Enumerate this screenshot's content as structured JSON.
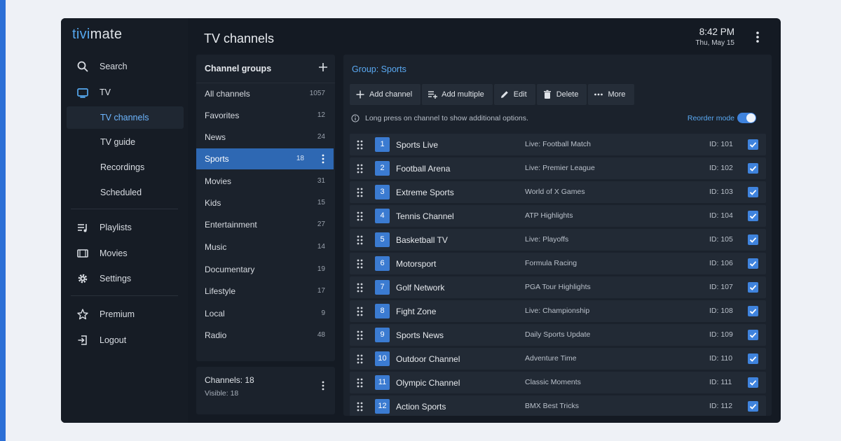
{
  "app": {
    "logo_part1": "tivi",
    "logo_part2": "mate",
    "title": "TV channels",
    "time": "8:42 PM",
    "date": "Thu, May 15"
  },
  "sidebar": {
    "search": "Search",
    "tv": "TV",
    "tv_channels": "TV channels",
    "tv_guide": "TV guide",
    "recordings": "Recordings",
    "scheduled": "Scheduled",
    "playlists": "Playlists",
    "movies": "Movies",
    "settings": "Settings",
    "premium": "Premium",
    "logout": "Logout"
  },
  "groups": {
    "header": "Channel groups",
    "items": [
      {
        "name": "All channels",
        "count": "1057"
      },
      {
        "name": "Favorites",
        "count": "12"
      },
      {
        "name": "News",
        "count": "24"
      },
      {
        "name": "Sports",
        "count": "18"
      },
      {
        "name": "Movies",
        "count": "31"
      },
      {
        "name": "Kids",
        "count": "15"
      },
      {
        "name": "Entertainment",
        "count": "27"
      },
      {
        "name": "Music",
        "count": "14"
      },
      {
        "name": "Documentary",
        "count": "19"
      },
      {
        "name": "Lifestyle",
        "count": "17"
      },
      {
        "name": "Local",
        "count": "9"
      },
      {
        "name": "Radio",
        "count": "48"
      }
    ]
  },
  "summary": {
    "channels": "Channels: 18",
    "visible": "Visible:  18"
  },
  "channels": {
    "group_label": "Group: Sports",
    "toolbar": {
      "add_channel": "Add channel",
      "add_multiple": "Add multiple",
      "edit": "Edit",
      "delete": "Delete",
      "more": "More"
    },
    "hint": "Long press on channel to show additional options.",
    "reorder_label": "Reorder mode",
    "reorder_on": true,
    "rows": [
      {
        "num": "1",
        "name": "Sports Live",
        "program": "Live: Football Match",
        "id": "ID: 101"
      },
      {
        "num": "2",
        "name": "Football Arena",
        "program": "Live: Premier League",
        "id": "ID: 102"
      },
      {
        "num": "3",
        "name": "Extreme Sports",
        "program": "World of X Games",
        "id": "ID: 103"
      },
      {
        "num": "4",
        "name": "Tennis Channel",
        "program": "ATP Highlights",
        "id": "ID: 104"
      },
      {
        "num": "5",
        "name": "Basketball TV",
        "program": "Live: Playoffs",
        "id": "ID: 105"
      },
      {
        "num": "6",
        "name": "Motorsport",
        "program": "Formula Racing",
        "id": "ID: 106"
      },
      {
        "num": "7",
        "name": "Golf Network",
        "program": "PGA Tour Highlights",
        "id": "ID: 107"
      },
      {
        "num": "8",
        "name": "Fight Zone",
        "program": "Live: Championship",
        "id": "ID: 108"
      },
      {
        "num": "9",
        "name": "Sports News",
        "program": "Daily Sports Update",
        "id": "ID: 109"
      },
      {
        "num": "10",
        "name": "Outdoor Channel",
        "program": "Adventure Time",
        "id": "ID: 110"
      },
      {
        "num": "11",
        "name": "Olympic Channel",
        "program": "Classic Moments",
        "id": "ID: 111"
      },
      {
        "num": "12",
        "name": "Action Sports",
        "program": "BMX Best Tricks",
        "id": "ID: 112"
      }
    ]
  },
  "colors": {
    "accent": "#3f83dd",
    "selected_group": "#2e68b3",
    "app_bg": "#141a23",
    "panel_bg": "#1b222c"
  }
}
